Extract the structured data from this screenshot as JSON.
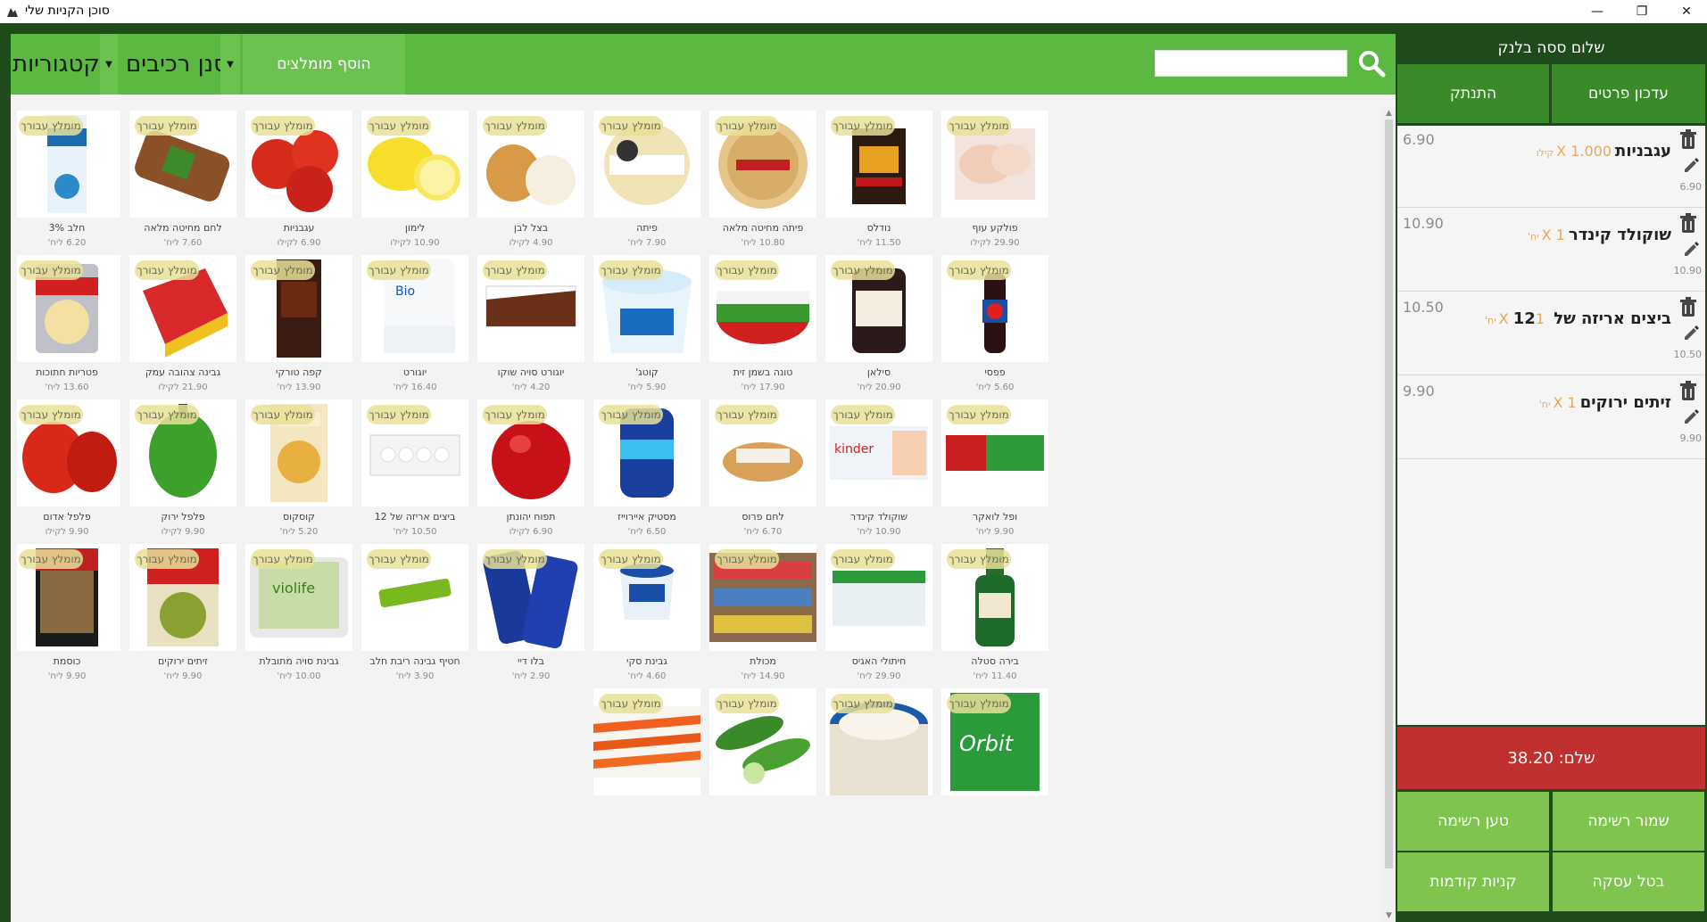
{
  "window": {
    "title": "סוכן הקניות שלי",
    "minimize": "—",
    "maximize": "❐",
    "close": "✕"
  },
  "toolbar": {
    "categories_label": "קטגוריות",
    "filter_label": "סנן רכיבים",
    "add_recommended_label": "הוסף מומלצים",
    "search_placeholder": ""
  },
  "badge_text": "מומלץ עבורך",
  "products": [
    {
      "name": "פולקע עוף",
      "price": "29.90 לקילו"
    },
    {
      "name": "נודלס",
      "price": "11.50 ליח'"
    },
    {
      "name": "פיתה מחיטה מלאה",
      "price": "10.80 ליח'"
    },
    {
      "name": "פיתה",
      "price": "7.90 ליח'"
    },
    {
      "name": "בצל לבן",
      "price": "4.90 לקילו"
    },
    {
      "name": "לימון",
      "price": "10.90 לקילו"
    },
    {
      "name": "עגבניות",
      "price": "6.90 לקילו"
    },
    {
      "name": "לחם מחיטה מלאה",
      "price": "7.60 ליח'"
    },
    {
      "name": "חלב 3%",
      "price": "6.20 ליח'"
    },
    {
      "name": "פפסי",
      "price": "5.60 ליח'"
    },
    {
      "name": "סילאן",
      "price": "20.90 ליח'"
    },
    {
      "name": "טונה בשמן זית",
      "price": "17.90 ליח'"
    },
    {
      "name": "קוטג'",
      "price": "5.90 ליח'"
    },
    {
      "name": "יוגורט סויה שוקו",
      "price": "4.20 ליח'"
    },
    {
      "name": "יוגורט",
      "price": "16.40 ליח'"
    },
    {
      "name": "קפה טורקי",
      "price": "13.90 ליח'"
    },
    {
      "name": "גבינה צהובה עמק",
      "price": "21.90 לקילו"
    },
    {
      "name": "פטריות חתוכות",
      "price": "13.60 ליח'"
    },
    {
      "name": "ופל לואקר",
      "price": "9.90 ליח'"
    },
    {
      "name": "שוקולד קינדר",
      "price": "10.90 ליח'"
    },
    {
      "name": "לחם פרוס",
      "price": "6.70 ליח'"
    },
    {
      "name": "מסטיק איירוייז",
      "price": "6.50 ליח'"
    },
    {
      "name": "תפוח יהונתן",
      "price": "6.90 לקילו"
    },
    {
      "name": "ביצים אריזה של 12",
      "price": "10.50 ליח'"
    },
    {
      "name": "קוסקוס",
      "price": "5.20 ליח'"
    },
    {
      "name": "פלפל ירוק",
      "price": "9.90 לקילו"
    },
    {
      "name": "פלפל אדום",
      "price": "9.90 לקילו"
    },
    {
      "name": "בירה סטלה",
      "price": "11.40 ליח'"
    },
    {
      "name": "חיתולי האגיס",
      "price": "29.90 ליח'"
    },
    {
      "name": "מכולת",
      "price": "14.90 ליח'"
    },
    {
      "name": "גבינת סקי",
      "price": "4.60 ליח'"
    },
    {
      "name": "בלו דיי",
      "price": "2.90 ליח'"
    },
    {
      "name": "חטיף גבינה ריבת חלב",
      "price": "3.90 ליח'"
    },
    {
      "name": "גבינת סויה מתובלת",
      "price": "10.00 ליח'"
    },
    {
      "name": "זיתים ירוקים",
      "price": "9.90 ליח'"
    },
    {
      "name": "כוסמת",
      "price": "9.90 ליח'"
    },
    {
      "name": "",
      "price": ""
    },
    {
      "name": "",
      "price": ""
    },
    {
      "name": "",
      "price": ""
    },
    {
      "name": "",
      "price": ""
    }
  ],
  "sidebar": {
    "greeting": "שלום ססה בלנק",
    "update_details": "עדכון פרטים",
    "logout": "התנתק"
  },
  "cart": {
    "items": [
      {
        "name": "עגבניות",
        "qty": "1.000 X",
        "unit": "קילו",
        "price": "6.90",
        "total": "6.90"
      },
      {
        "name": "שוקולד קינדר",
        "qty": "1 X",
        "unit": "יח'",
        "price": "10.90",
        "total": "10.90"
      },
      {
        "name": "ביצים אריזה של 12",
        "qty": "1 X",
        "unit": "יח'",
        "price": "10.50",
        "total": "10.50"
      },
      {
        "name": "זיתים ירוקים",
        "qty": "1 X",
        "unit": "יח'",
        "price": "9.90",
        "total": "9.90"
      }
    ],
    "total_label": "שלם: 38.20"
  },
  "actions": {
    "save_list": "שמור רשימה",
    "load_list": "טען רשימה",
    "cancel": "בטל עסקה",
    "previous": "קניות קודמות"
  },
  "colors": {
    "accent_green": "#5bb942",
    "dark_green": "#1f4a1c",
    "pay_red": "#c0302f",
    "action_green": "#7fc44f"
  }
}
